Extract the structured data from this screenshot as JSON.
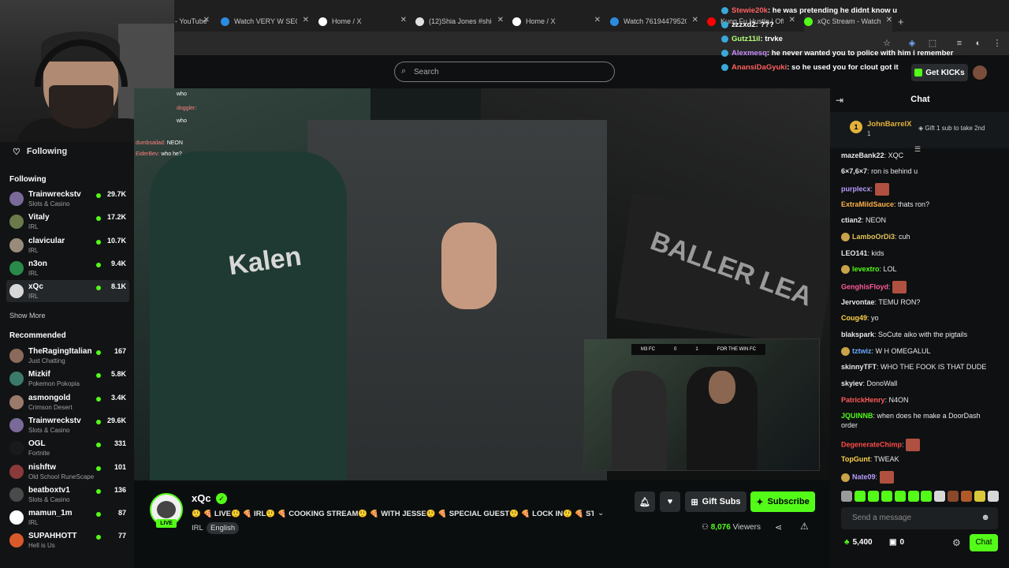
{
  "browser": {
    "tabs": [
      {
        "label": "- YouTube",
        "color": "#ff0000"
      },
      {
        "label": "Watch VERY W SEGM",
        "color": "#2b8be0"
      },
      {
        "label": "Home / X",
        "color": "#ffffff"
      },
      {
        "label": "(12)Shia Jones #shia",
        "color": "#e0e0e0"
      },
      {
        "label": "Home / X",
        "color": "#ffffff"
      },
      {
        "label": "Watch 761944795207",
        "color": "#2b8be0"
      },
      {
        "label": "Kung Fu Hustle | Offi",
        "color": "#ff0000"
      },
      {
        "label": "xQc Stream - Watch",
        "color": "#53fc18"
      }
    ],
    "new_tab": "+"
  },
  "top_overlay_chat": [
    {
      "user": "Stewie20k",
      "text": "he was pretending he didnt know u",
      "color": "#ff6060"
    },
    {
      "user": "zzzxd2",
      "text": "???",
      "color": "#ffffff"
    },
    {
      "user": "Gutz11il",
      "text": "trvke",
      "color": "#b4ff7a"
    },
    {
      "user": "Alexmesq",
      "text": "he never wanted you to police with him i remember",
      "color": "#c48bff"
    },
    {
      "user": "AnansiDaGyuki",
      "text": "so he used you for clout got it",
      "color": "#ff6060"
    }
  ],
  "header": {
    "search_placeholder": "Search",
    "get_kicks": "Get KICKs"
  },
  "sidebar": {
    "following_header": "Following",
    "following_title": "Following",
    "following": [
      {
        "name": "Trainwreckstv",
        "category": "Slots & Casino",
        "viewers": "29.7K",
        "color": "#7a6a9a"
      },
      {
        "name": "Vitaly",
        "category": "IRL",
        "viewers": "17.2K",
        "color": "#6a7a4a"
      },
      {
        "name": "clavicular",
        "category": "IRL",
        "viewers": "10.7K",
        "color": "#9a8a7a"
      },
      {
        "name": "n3on",
        "category": "IRL",
        "viewers": "9.4K",
        "color": "#2a8a4a"
      },
      {
        "name": "xQc",
        "category": "IRL",
        "viewers": "8.1K",
        "color": "#d8d8d8"
      }
    ],
    "show_more": "Show More",
    "recommended_title": "Recommended",
    "recommended": [
      {
        "name": "TheRagingItalian",
        "category": "Just Chatting",
        "viewers": "167",
        "color": "#8a6a5a"
      },
      {
        "name": "Mizkif",
        "category": "Pokemon Pokopia",
        "viewers": "5.8K",
        "color": "#3a7a6a"
      },
      {
        "name": "asmongold",
        "category": "Crimson Desert",
        "viewers": "3.4K",
        "color": "#9a7a6a"
      },
      {
        "name": "Trainwreckstv",
        "category": "Slots & Casino",
        "viewers": "29.6K",
        "color": "#7a6a9a"
      },
      {
        "name": "OGL",
        "category": "Fortnite",
        "viewers": "331",
        "color": "#1a1a1a"
      },
      {
        "name": "nishftw",
        "category": "Old School RuneScape",
        "viewers": "101",
        "color": "#8a3a3a"
      },
      {
        "name": "beatboxtv1",
        "category": "Slots & Casino",
        "viewers": "136",
        "color": "#4a4a4a"
      },
      {
        "name": "mamun_1m",
        "category": "IRL",
        "viewers": "87",
        "color": "#ffffff"
      },
      {
        "name": "SUPAHHOTT",
        "category": "Hell is Us",
        "viewers": "77",
        "color": "#d85a2a"
      }
    ]
  },
  "video": {
    "shirt_text": "Kalen",
    "banner_text": "BALLER LEA",
    "overlay_chat": [
      {
        "user": "",
        "text": "who"
      },
      {
        "user": "doggler:",
        "text": ""
      },
      {
        "user": "",
        "text": "who"
      },
      {
        "user": "dumbsailad:",
        "text": "NEON"
      },
      {
        "user": "EiderBev:",
        "text": "who he?"
      }
    ],
    "pip_scorebar": [
      "M3 FC",
      "0",
      "1",
      "FOR THE WIN FC"
    ]
  },
  "stream": {
    "name": "xQc",
    "live": "LIVE",
    "title": "🤨 🍕 LIVE🤨 🍕 IRL🤨 🍕 COOKING STREAM🤨 🍕 WITH JESSE🤨 🍕 SPECIAL GUEST🤨 🍕 LOCK IN🤨 🍕 STORE ...",
    "category": "IRL",
    "language": "English",
    "viewers_count": "8,076",
    "viewers_label": "Viewers",
    "gift_subs": "Gift Subs",
    "subscribe": "Subscribe"
  },
  "chat": {
    "title": "Chat",
    "pinned_user": "JohnBarrelX",
    "pinned_rank": "1",
    "pinned_sub": "1",
    "pinned_gift": "Gift 1 sub to take 2nd",
    "messages": [
      {
        "user": "mazeBank22",
        "text": "XQC",
        "color": "#e8e8e8",
        "badge": false
      },
      {
        "user": "6×7,6×7",
        "text": "ron is behind u",
        "color": "#e8e8e8",
        "badge": false
      },
      {
        "user": "purplecx",
        "text": "",
        "color": "#b99cff",
        "badge": false
      },
      {
        "user": "ExtraMildSauce",
        "text": "thats ron?",
        "color": "#ffb04a",
        "badge": false
      },
      {
        "user": "ctian2",
        "text": "NEON",
        "color": "#e8e8e8",
        "badge": false
      },
      {
        "user": "LamboOrDi3",
        "text": "cuh",
        "color": "#e3c25a",
        "badge": true
      },
      {
        "user": "LEO141",
        "text": "kids",
        "color": "#e8e8e8",
        "badge": false
      },
      {
        "user": "levextro",
        "text": "LOL",
        "color": "#53fc18",
        "badge": true
      },
      {
        "user": "GenghisFloyd",
        "text": "",
        "color": "#ff5a9a",
        "badge": false
      },
      {
        "user": "Jervontae",
        "text": "TEMU RON?",
        "color": "#e8e8e8",
        "badge": false
      },
      {
        "user": "Coug49",
        "text": "yo",
        "color": "#ffd24a",
        "badge": false
      },
      {
        "user": "blakspark",
        "text": "SoCute aiko with the pigtails",
        "color": "#e8e8e8",
        "badge": false
      },
      {
        "user": "tztwiz",
        "text": "W H OMEGALUL",
        "color": "#6aa8ff",
        "badge": true
      },
      {
        "user": "skinnyTFT",
        "text": "WHO THE FOOK IS THAT DUDE",
        "color": "#e8e8e8",
        "badge": false
      },
      {
        "user": "skyiev",
        "text": "DonoWall",
        "color": "#e8e8e8",
        "badge": false
      },
      {
        "user": "PatrickHenry",
        "text": "N4ON",
        "color": "#ff5a5a",
        "badge": false
      },
      {
        "user": "JQUINNB",
        "text": "when does he make a DoorDash order",
        "color": "#53fc18",
        "badge": false
      },
      {
        "user": "DegenerateChimp",
        "text": "",
        "color": "#ff4a4a",
        "badge": false
      },
      {
        "user": "TopGunt",
        "text": "TWEAK",
        "color": "#ffd24a",
        "badge": false
      },
      {
        "user": "Nate09",
        "text": "",
        "color": "#b99cff",
        "badge": true
      }
    ],
    "input_placeholder": "Send a message",
    "kicks_balance": "5,400",
    "points": "0",
    "send_label": "Chat"
  },
  "colors": {
    "accent": "#53fc18",
    "background": "#0b0e0f"
  }
}
